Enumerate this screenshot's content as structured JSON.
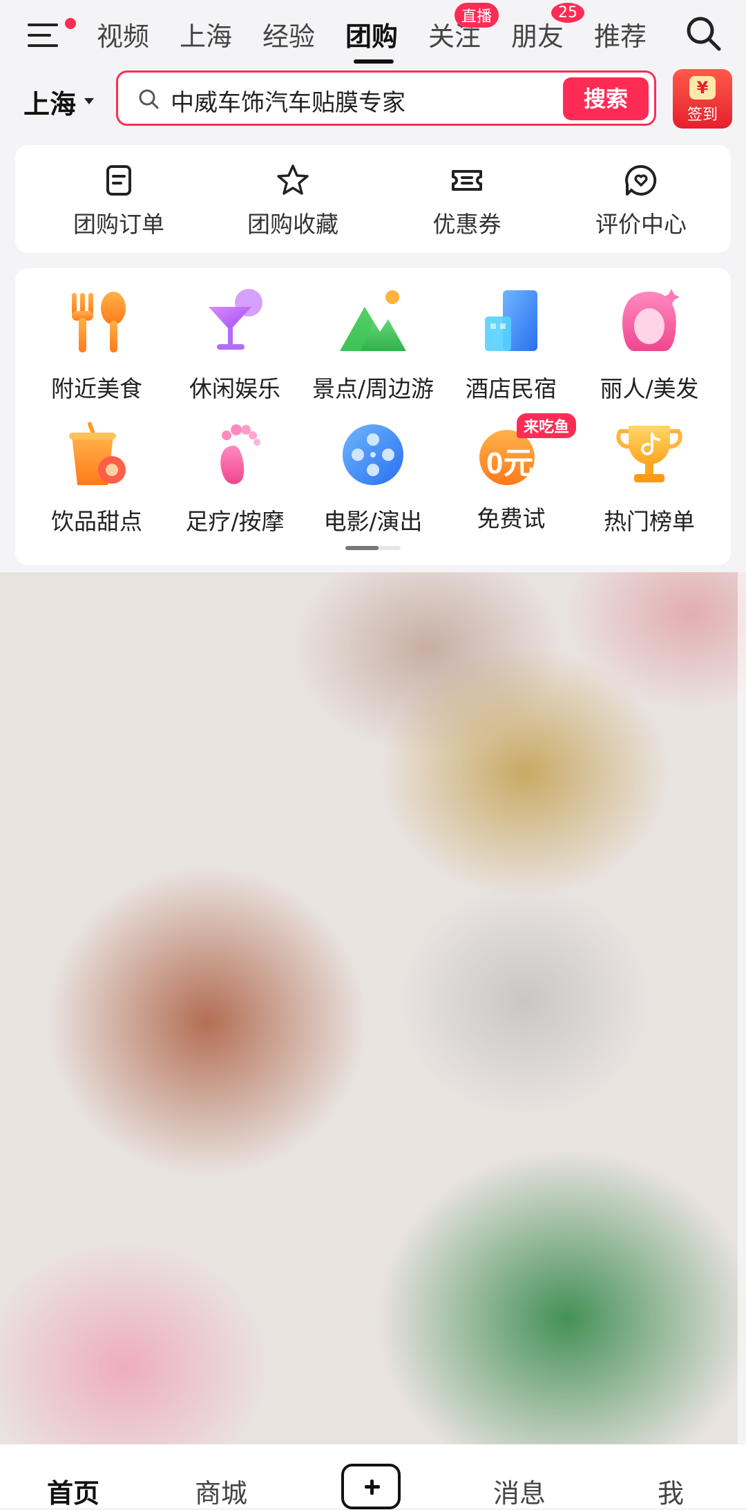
{
  "top_tabs": [
    {
      "label": "视频"
    },
    {
      "label": "上海"
    },
    {
      "label": "经验"
    },
    {
      "label": "团购"
    },
    {
      "label": "关注",
      "badge": "直播"
    },
    {
      "label": "朋友",
      "badge": "25"
    },
    {
      "label": "推荐"
    }
  ],
  "active_tab": "团购",
  "location": {
    "city": "上海"
  },
  "search": {
    "query": "中威车饰汽车贴膜专家",
    "button": "搜索"
  },
  "sign_in": {
    "label": "签到",
    "coin": "¥"
  },
  "quick_actions": [
    {
      "label": "团购订单",
      "icon": "order-icon"
    },
    {
      "label": "团购收藏",
      "icon": "star-icon"
    },
    {
      "label": "优惠券",
      "icon": "coupon-icon"
    },
    {
      "label": "评价中心",
      "icon": "review-icon"
    }
  ],
  "categories": [
    {
      "label": "附近美食",
      "icon": "food-icon"
    },
    {
      "label": "休闲娱乐",
      "icon": "cocktail-icon"
    },
    {
      "label": "景点/周边游",
      "icon": "mountain-icon"
    },
    {
      "label": "酒店民宿",
      "icon": "hotel-icon"
    },
    {
      "label": "丽人/美发",
      "icon": "beauty-icon"
    },
    {
      "label": "饮品甜点",
      "icon": "drink-icon"
    },
    {
      "label": "足疗/按摩",
      "icon": "foot-icon"
    },
    {
      "label": "电影/演出",
      "icon": "film-icon"
    },
    {
      "label": "免费试",
      "icon": "free-trial-icon",
      "badge": "来吃鱼",
      "icon_text": "0元"
    },
    {
      "label": "热门榜单",
      "icon": "trophy-icon"
    }
  ],
  "bottom_nav": [
    {
      "label": "首页"
    },
    {
      "label": "商城"
    },
    {
      "label": "+"
    },
    {
      "label": "消息"
    },
    {
      "label": "我"
    }
  ],
  "colors": {
    "accent": "#fe2c55",
    "text": "#222222",
    "background": "#f4f4f6"
  }
}
